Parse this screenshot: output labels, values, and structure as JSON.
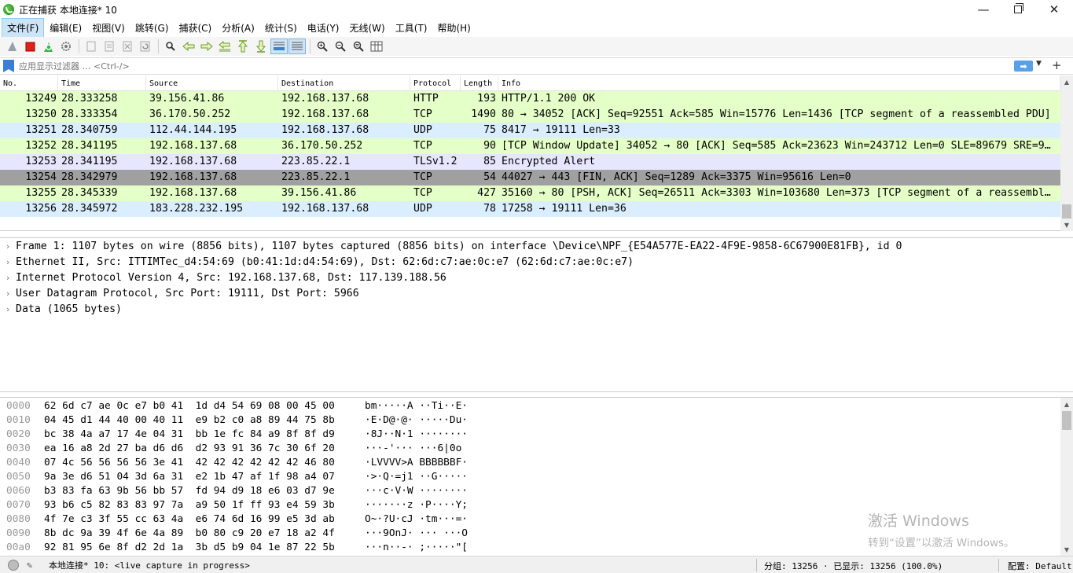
{
  "window": {
    "title": "正在捕获 本地连接* 10",
    "minimize": "—",
    "close": "✕"
  },
  "menu": [
    "文件(F)",
    "编辑(E)",
    "视图(V)",
    "跳转(G)",
    "捕获(C)",
    "分析(A)",
    "统计(S)",
    "电话(Y)",
    "无线(W)",
    "工具(T)",
    "帮助(H)"
  ],
  "toolbar": {
    "icons": [
      "shark-fin-start-icon",
      "stop-icon",
      "restart-icon",
      "options-gear-icon",
      "open-file-icon",
      "save-file-icon",
      "close-file-icon",
      "reload-icon",
      "find-icon",
      "back-arrow-icon",
      "forward-arrow-icon",
      "goto-packet-icon",
      "first-packet-icon",
      "last-packet-icon",
      "autoscroll-icon",
      "colorize-icon",
      "zoom-in-icon",
      "zoom-out-icon",
      "zoom-normal-icon",
      "resize-columns-icon"
    ]
  },
  "filter": {
    "placeholder": "应用显示过滤器 … <Ctrl-/>",
    "apply": "➡"
  },
  "packet_list": {
    "columns": [
      "No.",
      "Time",
      "Source",
      "Destination",
      "Protocol",
      "Length",
      "Info"
    ],
    "rows": [
      {
        "no": "13249",
        "time": "28.333258",
        "src": "39.156.41.86",
        "dst": "192.168.137.68",
        "proto": "HTTP",
        "len": "193",
        "info": "HTTP/1.1 200 OK",
        "bg": "#e4ffc7"
      },
      {
        "no": "13250",
        "time": "28.333354",
        "src": "36.170.50.252",
        "dst": "192.168.137.68",
        "proto": "TCP",
        "len": "1490",
        "info": "80 → 34052 [ACK] Seq=92551 Ack=585 Win=15776 Len=1436 [TCP segment of a reassembled PDU]",
        "bg": "#e4ffc7"
      },
      {
        "no": "13251",
        "time": "28.340759",
        "src": "112.44.144.195",
        "dst": "192.168.137.68",
        "proto": "UDP",
        "len": "75",
        "info": "8417 → 19111 Len=33",
        "bg": "#daeeff"
      },
      {
        "no": "13252",
        "time": "28.341195",
        "src": "192.168.137.68",
        "dst": "36.170.50.252",
        "proto": "TCP",
        "len": "90",
        "info": "[TCP Window Update] 34052 → 80 [ACK] Seq=585 Ack=23623 Win=243712 Len=0 SLE=89679 SRE=9…",
        "bg": "#e4ffc7"
      },
      {
        "no": "13253",
        "time": "28.341195",
        "src": "192.168.137.68",
        "dst": "223.85.22.1",
        "proto": "TLSv1.2",
        "len": "85",
        "info": "Encrypted Alert",
        "bg": "#e7e6ff"
      },
      {
        "no": "13254",
        "time": "28.342979",
        "src": "192.168.137.68",
        "dst": "223.85.22.1",
        "proto": "TCP",
        "len": "54",
        "info": "44027 → 443 [FIN, ACK] Seq=1289 Ack=3375 Win=95616 Len=0",
        "bg": "#a0a0a0"
      },
      {
        "no": "13255",
        "time": "28.345339",
        "src": "192.168.137.68",
        "dst": "39.156.41.86",
        "proto": "TCP",
        "len": "427",
        "info": "35160 → 80 [PSH, ACK] Seq=26511 Ack=3303 Win=103680 Len=373 [TCP segment of a reassembl…",
        "bg": "#e4ffc7"
      },
      {
        "no": "13256",
        "time": "28.345972",
        "src": "183.228.232.195",
        "dst": "192.168.137.68",
        "proto": "UDP",
        "len": "78",
        "info": "17258 → 19111 Len=36",
        "bg": "#daeeff"
      }
    ]
  },
  "details": [
    "Frame 1: 1107 bytes on wire (8856 bits), 1107 bytes captured (8856 bits) on interface \\Device\\NPF_{E54A577E-EA22-4F9E-9858-6C67900E81FB}, id 0",
    "Ethernet II, Src: ITTIMTec_d4:54:69 (b0:41:1d:d4:54:69), Dst: 62:6d:c7:ae:0c:e7 (62:6d:c7:ae:0c:e7)",
    "Internet Protocol Version 4, Src: 192.168.137.68, Dst: 117.139.188.56",
    "User Datagram Protocol, Src Port: 19111, Dst Port: 5966",
    "Data (1065 bytes)"
  ],
  "bytes": [
    {
      "off": "0000",
      "hex": "62 6d c7 ae 0c e7 b0 41  1d d4 54 69 08 00 45 00",
      "ascii": "bm·····A ··Ti··E·"
    },
    {
      "off": "0010",
      "hex": "04 45 d1 44 40 00 40 11  e9 b2 c0 a8 89 44 75 8b",
      "ascii": "·E·D@·@· ·····Du·"
    },
    {
      "off": "0020",
      "hex": "bc 38 4a a7 17 4e 04 31  bb 1e fc 84 a9 8f 8f d9",
      "ascii": "·8J··N·1 ········"
    },
    {
      "off": "0030",
      "hex": "ea 16 a8 2d 27 ba d6 d6  d2 93 91 36 7c 30 6f 20",
      "ascii": "···-'··· ···6|0o "
    },
    {
      "off": "0040",
      "hex": "07 4c 56 56 56 56 3e 41  42 42 42 42 42 42 46 80",
      "ascii": "·LVVVV>A BBBBBBF·"
    },
    {
      "off": "0050",
      "hex": "9a 3e d6 51 04 3d 6a 31  e2 1b 47 af 1f 98 a4 07",
      "ascii": "·>·Q·=j1 ··G·····"
    },
    {
      "off": "0060",
      "hex": "b3 83 fa 63 9b 56 bb 57  fd 94 d9 18 e6 03 d7 9e",
      "ascii": "···c·V·W ········"
    },
    {
      "off": "0070",
      "hex": "93 b6 c5 82 83 83 97 7a  a9 50 1f ff 93 e4 59 3b",
      "ascii": "·······z ·P····Y;"
    },
    {
      "off": "0080",
      "hex": "4f 7e c3 3f 55 cc 63 4a  e6 74 6d 16 99 e5 3d ab",
      "ascii": "O~·?U·cJ ·tm···=·"
    },
    {
      "off": "0090",
      "hex": "8b dc 9a 39 4f 6e 4a 89  b0 80 c9 20 e7 18 a2 4f",
      "ascii": "···9OnJ· ··· ···O"
    },
    {
      "off": "00a0",
      "hex": "92 81 95 6e 8f d2 2d 1a  3b d5 b9 04 1e 87 22 5b",
      "ascii": "···n··-· ;·····\"["
    }
  ],
  "watermark": {
    "line1": "激活 Windows",
    "line2": "转到“设置”以激活 Windows。"
  },
  "status": {
    "capture": "本地连接* 10: <live capture in progress>",
    "packets": "分组: 13256 · 已显示: 13256 (100.0%)",
    "profile": "配置: Default"
  }
}
